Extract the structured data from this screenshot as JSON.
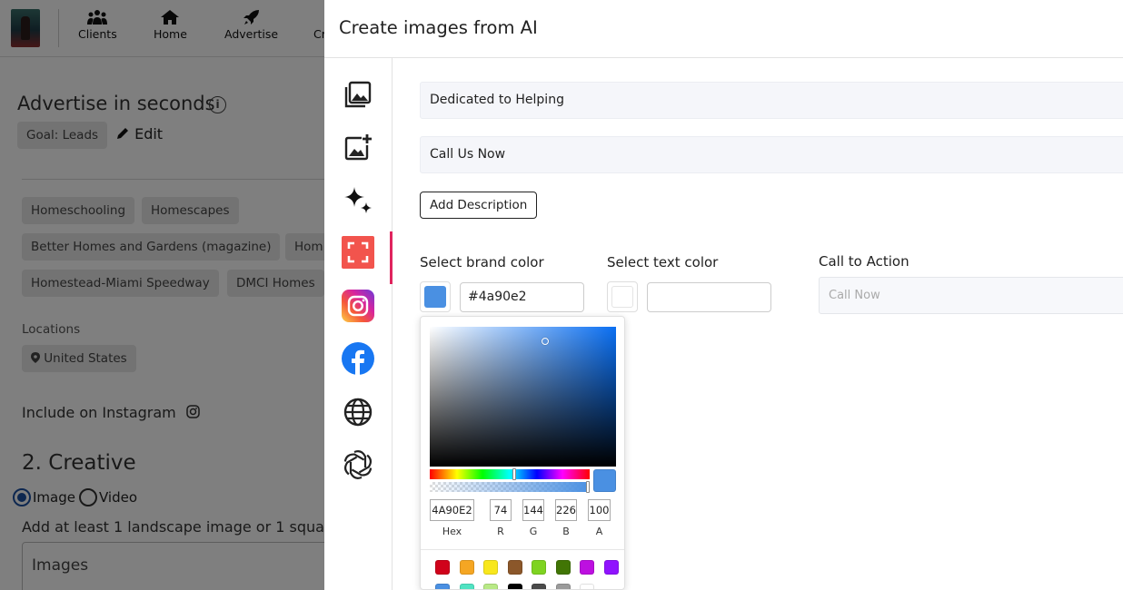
{
  "nav": {
    "items": [
      {
        "label": "Clients",
        "icon": "users-icon"
      },
      {
        "label": "Home",
        "icon": "home-icon"
      },
      {
        "label": "Advertise",
        "icon": "rocket-icon"
      },
      {
        "label": "Cr",
        "icon": "none"
      }
    ]
  },
  "background": {
    "advertise_title": "Advertise in seconds",
    "goal_chip": "Goal: Leads",
    "edit_label": "Edit",
    "keywords": [
      "Homeschooling",
      "Homescapes",
      "Better Homes and Gardens (magazine)",
      "Hom",
      "Homestead-Miami Speedway",
      "DMCI Homes"
    ],
    "locations_label": "Locations",
    "location_chip": "United States",
    "include_instagram": "Include on Instagram",
    "creative_title": "2. Creative",
    "radio_image": "Image",
    "radio_video": "Video",
    "add_line": "Add at least 1 landscape image or 1 squa",
    "images_label": "Images"
  },
  "panel": {
    "title": "Create images from AI",
    "sidebar_icons": [
      "gallery-icon",
      "add-image-icon",
      "sparkle-icon",
      "crop-icon",
      "instagram-icon",
      "facebook-icon",
      "globe-icon",
      "openai-icon"
    ],
    "headline_1": "Dedicated to Helping",
    "headline_2": "Call Us Now",
    "add_description": "Add Description",
    "brand_color_label": "Select brand color",
    "brand_color_value": "#4a90e2",
    "text_color_label": "Select text color",
    "text_color_value": "",
    "cta_label": "Call to Action",
    "cta_placeholder": "Call Now"
  },
  "picker": {
    "hex": "4A90E2",
    "r": "74",
    "g": "144",
    "b": "226",
    "a": "100",
    "labels": {
      "hex": "Hex",
      "r": "R",
      "g": "G",
      "b": "B",
      "a": "A"
    },
    "presets": [
      "#d0021b",
      "#f5a623",
      "#f8e71c",
      "#8b572a",
      "#7ed321",
      "#417505",
      "#bd10e0",
      "#9013fe",
      "#4a90e2",
      "#50e3c2",
      "#b8e986",
      "#000000",
      "#4a4a4a",
      "#9b9b9b",
      "#ffffff"
    ]
  },
  "colors": {
    "accent": "#e0245e",
    "brand": "#4a90e2"
  }
}
